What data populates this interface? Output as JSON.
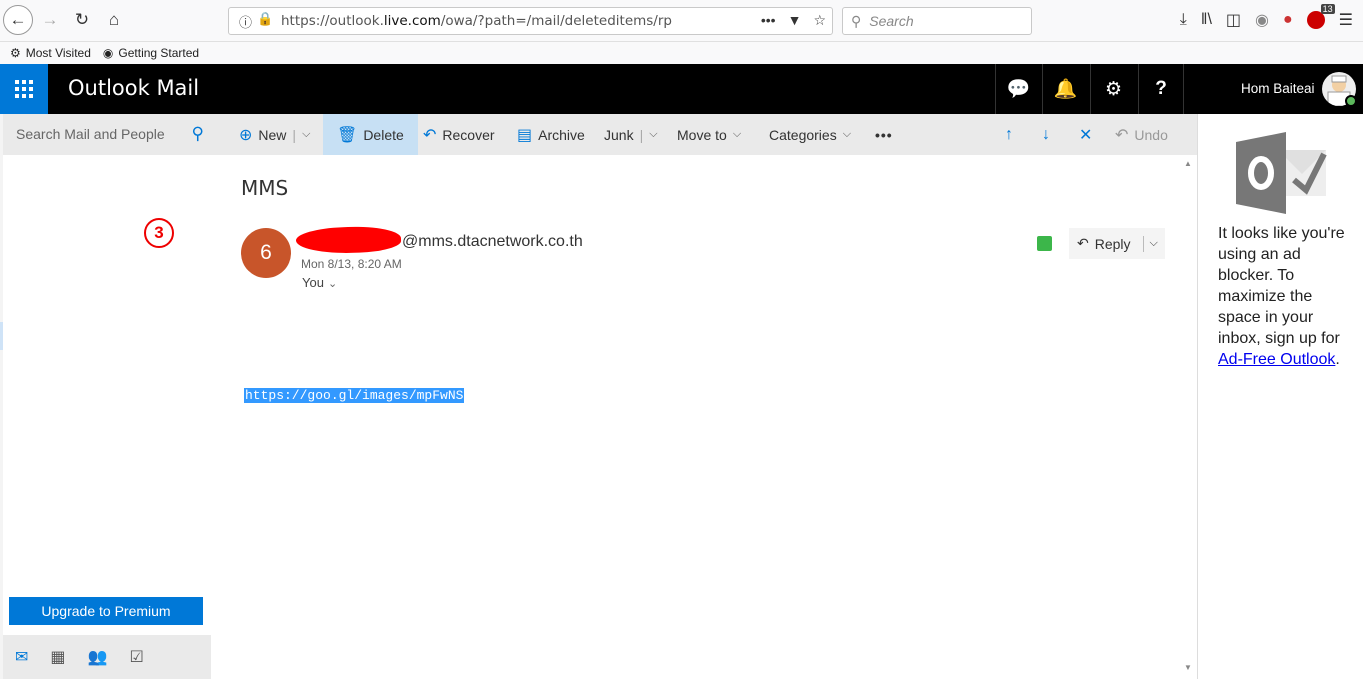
{
  "browser": {
    "url": "https://outlook.live.com/owa/?path=/mail/deleteditems/rp",
    "url_prefix": "https://outlook.",
    "url_domain": "live.com",
    "url_suffix": "/owa/?path=/mail/deleteditems/rp",
    "search_placeholder": "Search",
    "addon_badge": "13",
    "bookmarks": [
      "Most Visited",
      "Getting Started"
    ]
  },
  "app": {
    "title": "Outlook Mail",
    "user_name": "Hom Baiteai"
  },
  "left_pane": {
    "search_placeholder": "Search Mail and People",
    "annotation_marker": "3",
    "upgrade_label": "Upgrade to Premium"
  },
  "command_bar": {
    "new": "New",
    "delete": "Delete",
    "recover": "Recover",
    "archive": "Archive",
    "junk": "Junk",
    "move_to": "Move to",
    "categories": "Categories",
    "undo": "Undo"
  },
  "message": {
    "subject": "MMS",
    "sender_initial": "6",
    "sender_email": "@mms.dtacnetwork.co.th",
    "sent_time": "Mon 8/13, 8:20 AM",
    "recipient": "You",
    "reply_label": "Reply",
    "body_link": "https://goo.gl/images/mpFwNS"
  },
  "ad": {
    "text": "It looks like you're using an ad blocker. To maximize the space in your inbox, sign up for",
    "link_text": "Ad-Free Outlook",
    "after_link": "."
  },
  "colors": {
    "accent": "#0078d7",
    "header_bg": "#000000",
    "sender_avatar": "#c8552a",
    "annotation": "#e00000"
  }
}
